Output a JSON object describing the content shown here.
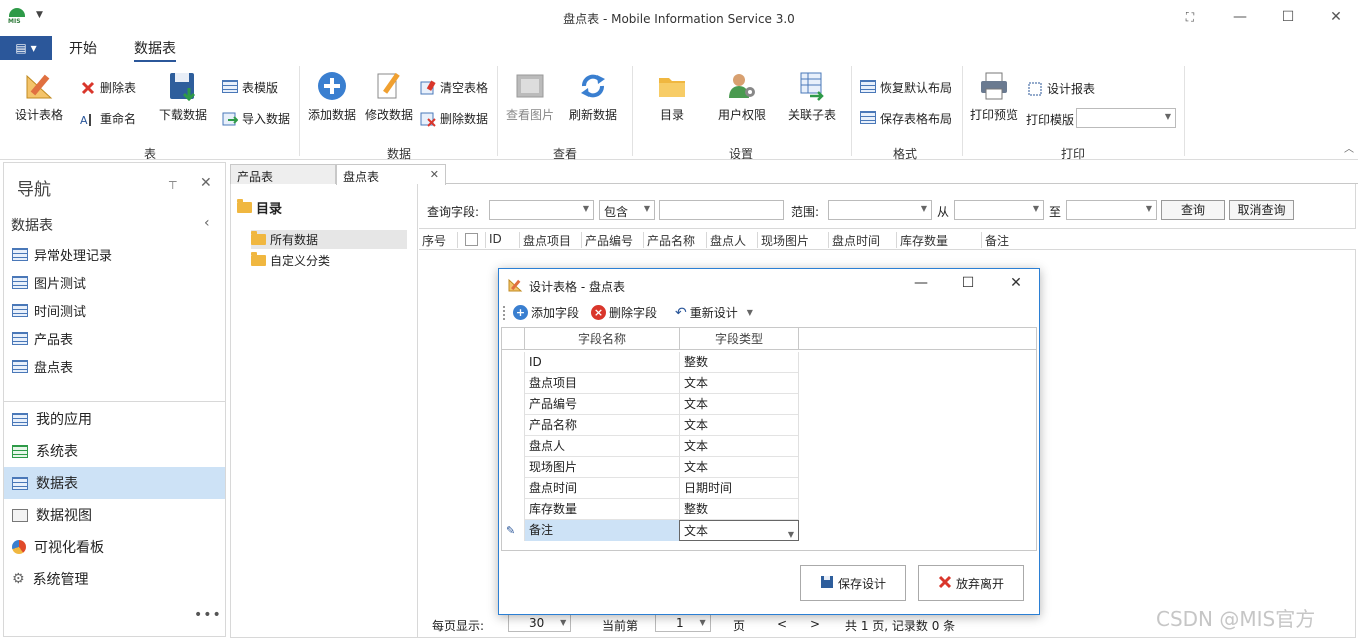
{
  "window": {
    "title": "盘点表 - Mobile Information Service 3.0",
    "logo_text": "MIS"
  },
  "menu": {
    "file_glyph": "▤",
    "tabs": [
      "开始",
      "数据表"
    ],
    "active_tab": "数据表"
  },
  "ribbon": {
    "groups": {
      "table": "表",
      "data": "数据",
      "view": "查看",
      "settings": "设置",
      "format": "格式",
      "print": "打印"
    },
    "design_table": "设计表格",
    "delete_table": "删除表",
    "rename": "重命名",
    "download_data": "下载数据",
    "table_template": "表模版",
    "import_data": "导入数据",
    "add_data": "添加数据",
    "edit_data": "修改数据",
    "clear_table": "清空表格",
    "delete_data": "删除数据",
    "view_image": "查看图片",
    "refresh_data": "刷新数据",
    "catalog": "目录",
    "user_permissions": "用户权限",
    "related_subtable": "关联子表",
    "restore_layout": "恢复默认布局",
    "save_layout": "保存表格布局",
    "print_preview": "打印预览",
    "design_report": "设计报表",
    "print_template": "打印模版",
    "print_template_value": ""
  },
  "nav": {
    "title": "导航",
    "section": "数据表",
    "tables": [
      "异常处理记录",
      "图片测试",
      "时间测试",
      "产品表",
      "盘点表"
    ],
    "bottom": [
      "我的应用",
      "系统表",
      "数据表",
      "数据视图",
      "可视化看板",
      "系统管理"
    ],
    "selected_bottom": "数据表",
    "more": "•••"
  },
  "doc_tabs": [
    "产品表",
    "盘点表"
  ],
  "active_doc_tab": "盘点表",
  "tree": {
    "root": "目录",
    "items": [
      "所有数据",
      "自定义分类"
    ],
    "selected": "所有数据"
  },
  "query": {
    "field_label": "查询字段:",
    "field_value": "",
    "op_value": "包含",
    "keyword": "",
    "range_label": "范围:",
    "range_value": "",
    "from_label": "从",
    "to_label": "至",
    "query_btn": "查询",
    "cancel_btn": "取消查询"
  },
  "grid": {
    "columns": [
      "序号",
      "",
      "ID",
      "盘点项目",
      "产品编号",
      "产品名称",
      "盘点人",
      "现场图片",
      "盘点时间",
      "库存数量",
      "备注"
    ]
  },
  "pager": {
    "per_page_label": "每页显示:",
    "per_page": "30",
    "current_label": "当前第",
    "current": "1",
    "page_unit": "页",
    "prev": "<",
    "next": ">",
    "total_text": "共 1 页, 记录数 0 条"
  },
  "dialog": {
    "title": "设计表格 - 盘点表",
    "add_field": "添加字段",
    "delete_field": "删除字段",
    "redesign": "重新设计",
    "col_name": "字段名称",
    "col_type": "字段类型",
    "rows": [
      {
        "name": "ID",
        "type": "整数"
      },
      {
        "name": "盘点项目",
        "type": "文本"
      },
      {
        "name": "产品编号",
        "type": "文本"
      },
      {
        "name": "产品名称",
        "type": "文本"
      },
      {
        "name": "盘点人",
        "type": "文本"
      },
      {
        "name": "现场图片",
        "type": "文本"
      },
      {
        "name": "盘点时间",
        "type": "日期时间"
      },
      {
        "name": "库存数量",
        "type": "整数"
      },
      {
        "name": "备注",
        "type": "文本"
      }
    ],
    "selected_row": 8,
    "save_btn": "保存设计",
    "discard_btn": "放弃离开"
  },
  "watermark": "CSDN @MIS官方",
  "colors": {
    "accent": "#2b579a",
    "selection": "#cde2f6",
    "dialog_border": "#2b7fd4"
  }
}
